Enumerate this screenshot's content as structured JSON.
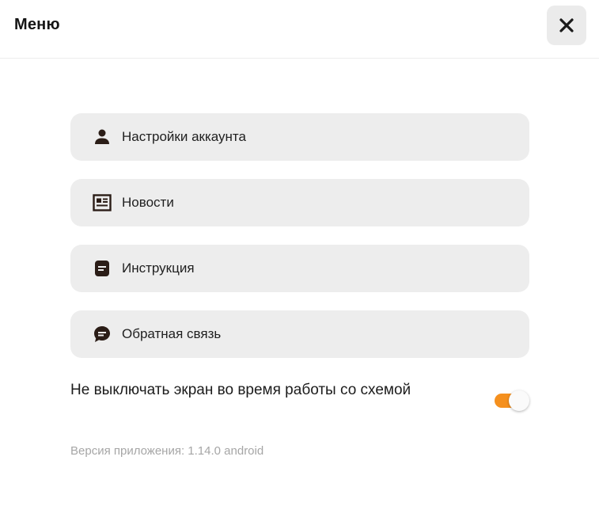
{
  "header": {
    "title": "Меню",
    "close_icon": "close-icon"
  },
  "menu": {
    "items": [
      {
        "label": "Настройки аккаунта",
        "icon": "user-icon"
      },
      {
        "label": "Новости",
        "icon": "newspaper-icon"
      },
      {
        "label": "Инструкция",
        "icon": "document-icon"
      },
      {
        "label": "Обратная связь",
        "icon": "chat-bubble-icon"
      }
    ]
  },
  "settings": {
    "keep_screen_on_label": "Не выключать экран во время работы со схемой",
    "keep_screen_on_enabled": true
  },
  "footer": {
    "version_text": "Версия приложения: 1.14.0 android"
  },
  "colors": {
    "accent": "#f5901e",
    "item_background": "#ededed",
    "icon_color": "#2b1d17"
  }
}
